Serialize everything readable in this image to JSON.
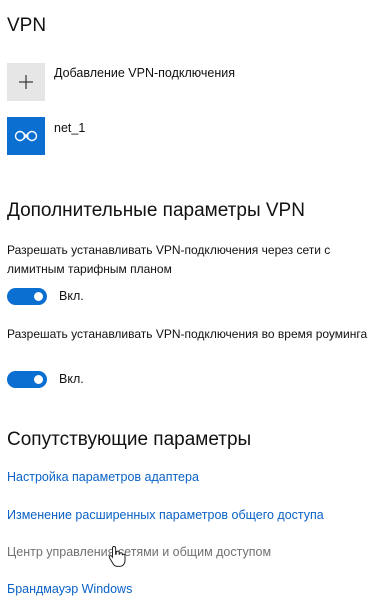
{
  "vpn": {
    "title": "VPN",
    "add_tile_icon": "plus-icon",
    "add_label": "Добавление VPN-подключения",
    "connection_icon": "vpn-connection-icon",
    "connection_name": "net_1"
  },
  "advanced": {
    "title": "Дополнительные параметры VPN",
    "metered": {
      "description": "Разрешать устанавливать VPN-подключения через сети с лимитным тарифным планом",
      "toggle_on": true,
      "state_label": "Вкл."
    },
    "roaming": {
      "description": "Разрешать устанавливать VPN-подключения во время роуминга",
      "toggle_on": true,
      "state_label": "Вкл."
    }
  },
  "related": {
    "title": "Сопутствующие параметры",
    "links": [
      "Настройка параметров адаптера",
      "Изменение расширенных параметров общего доступа",
      "Центр управления сетями и общим доступом",
      "Брандмауэр Windows"
    ]
  },
  "colors": {
    "accent": "#0a6fd0",
    "link": "#0a62c7",
    "dimmed_link": "#707070",
    "tile_gray": "#e6e6e6"
  },
  "cursor_icon": "hand-pointer-icon"
}
